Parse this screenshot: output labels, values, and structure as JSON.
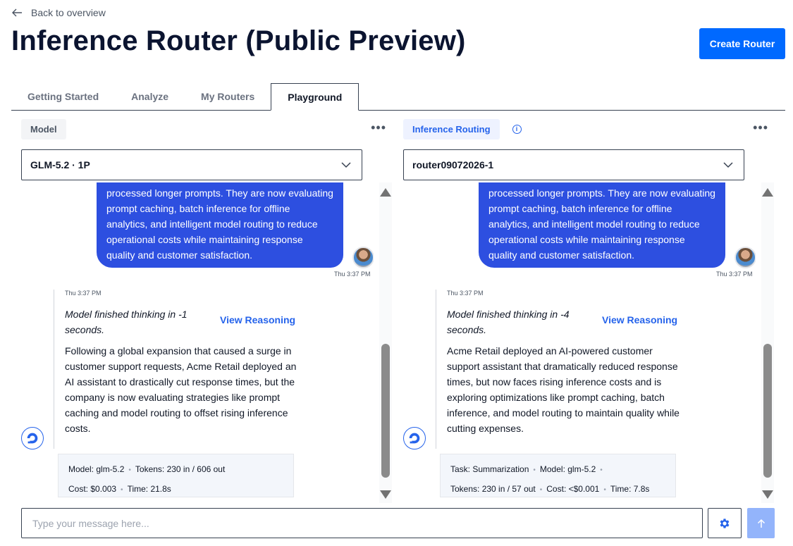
{
  "header": {
    "back_label": "Back to overview",
    "title": "Inference Router (Public Preview)",
    "create_button": "Create Router"
  },
  "tabs": [
    {
      "label": "Getting Started",
      "active": false
    },
    {
      "label": "Analyze",
      "active": false
    },
    {
      "label": "My Routers",
      "active": false
    },
    {
      "label": "Playground",
      "active": true
    }
  ],
  "colors": {
    "accent": "#0069ff",
    "user_bubble": "#2d4fe0",
    "link": "#2563eb"
  },
  "left_panel": {
    "label": "Model",
    "selected": "GLM-5.2 · 1P",
    "user_message": "processed longer prompts. They are now evaluating prompt caching, batch inference for offline analytics, and intelligent model routing to reduce operational costs while maintaining response quality and customer satisfaction.",
    "user_time": "Thu 3:37 PM",
    "bot_time": "Thu 3:37 PM",
    "thinking": "Model finished thinking in -1 seconds.",
    "view_reasoning": "View Reasoning",
    "bot_message": "Following a global expansion that caused a surge in customer support requests, Acme Retail deployed an AI assistant to drastically cut response times, but the company is now evaluating strategies like prompt caching and model routing to offset rising inference costs.",
    "meta": {
      "model": "Model: glm-5.2",
      "tokens": "Tokens: 230 in / 606 out",
      "cost": "Cost: $0.003",
      "time": "Time: 21.8s"
    }
  },
  "right_panel": {
    "label": "Inference Routing",
    "info_icon": "i",
    "selected": "router09072026-1",
    "user_message": "processed longer prompts. They are now evaluating prompt caching, batch inference for offline analytics, and intelligent model routing to reduce operational costs while maintaining response quality and customer satisfaction.",
    "user_time": "Thu 3:37 PM",
    "bot_time": "Thu 3:37 PM",
    "thinking": "Model finished thinking in -4 seconds.",
    "view_reasoning": "View Reasoning",
    "bot_message": "Acme Retail deployed an AI-powered customer support assistant that dramatically reduced response times, but now faces rising inference costs and is exploring optimizations like prompt caching, batch inference, and model routing to maintain quality while cutting expenses.",
    "meta": {
      "task": "Task: Summarization",
      "model": "Model: glm-5.2",
      "tokens": "Tokens: 230 in / 57 out",
      "cost": "Cost: <$0.001",
      "time": "Time: 7.8s"
    }
  },
  "composer": {
    "placeholder": "Type your message here..."
  }
}
